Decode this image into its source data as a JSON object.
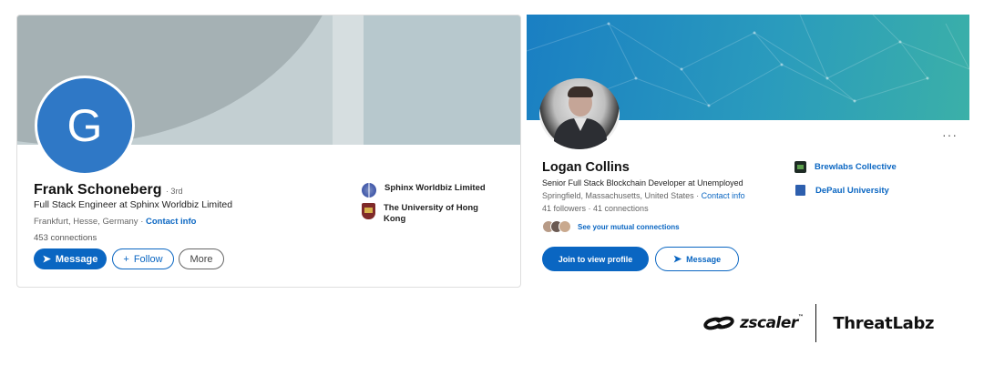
{
  "card1": {
    "avatar_letter": "G",
    "name": "Frank Schoneberg",
    "degree": "· 3rd",
    "headline": "Full Stack Engineer at Sphinx Worldbiz Limited",
    "location": "Frankfurt, Hesse, Germany ·",
    "contact_info": "Contact info",
    "connections": "453 connections",
    "buttons": {
      "message": "Message",
      "follow": "Follow",
      "more": "More"
    },
    "sidebar": [
      {
        "label": "Sphinx Worldbiz Limited",
        "icon": "globe-icon"
      },
      {
        "label": "The University of Hong Kong",
        "icon": "university-crest-icon"
      }
    ],
    "colors": {
      "primary": "#0a66c2",
      "avatar": "#2f78c6"
    }
  },
  "card2": {
    "name": "Logan Collins",
    "headline": "Senior Full Stack Blockchain Developer at Unemployed",
    "location": "Springfield, Massachusetts, United States ·",
    "contact_info": "Contact info",
    "stats": "41 followers · 41 connections",
    "mutual": "See your mutual connections",
    "more_icon": "···",
    "buttons": {
      "join": "Join to view profile",
      "message": "Message"
    },
    "sidebar": [
      {
        "label": "Brewlabs Collective",
        "icon": "brewlabs-logo-icon"
      },
      {
        "label": "DePaul University",
        "icon": "book-icon"
      }
    ]
  },
  "footer": {
    "brand_zscaler": "zscaler",
    "brand_threatlabz": "ThreatLabz"
  }
}
